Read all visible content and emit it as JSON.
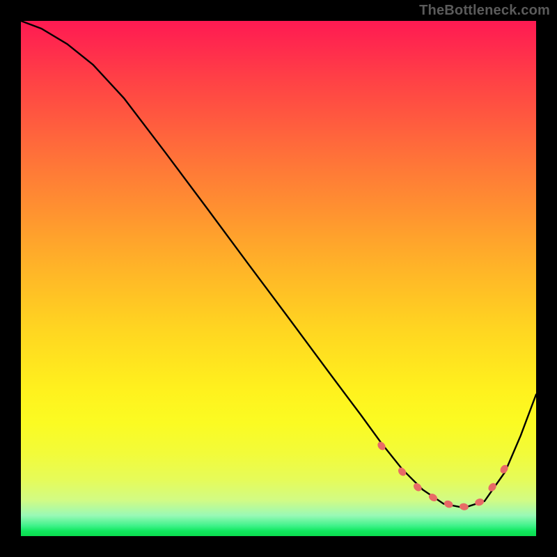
{
  "watermark": "TheBottleneck.com",
  "chart_data": {
    "type": "line",
    "title": "",
    "xlabel": "",
    "ylabel": "",
    "xlim": [
      0,
      1
    ],
    "ylim": [
      0,
      1
    ],
    "note": "Axes and scale are not labeled; x and y are normalized 0..1 where (0,0) is bottom-left of the plot area.",
    "series": [
      {
        "name": "curve",
        "x": [
          0.0,
          0.04,
          0.09,
          0.14,
          0.2,
          0.28,
          0.36,
          0.44,
          0.52,
          0.6,
          0.66,
          0.7,
          0.74,
          0.78,
          0.82,
          0.86,
          0.9,
          0.94,
          0.97,
          1.0
        ],
        "y": [
          1.0,
          0.985,
          0.955,
          0.915,
          0.85,
          0.745,
          0.638,
          0.53,
          0.423,
          0.315,
          0.235,
          0.18,
          0.13,
          0.09,
          0.063,
          0.055,
          0.068,
          0.125,
          0.195,
          0.275
        ]
      }
    ],
    "markers": {
      "name": "highlight-dots",
      "x": [
        0.7,
        0.74,
        0.77,
        0.8,
        0.83,
        0.86,
        0.89,
        0.915,
        0.938
      ],
      "y": [
        0.175,
        0.125,
        0.095,
        0.075,
        0.062,
        0.057,
        0.066,
        0.095,
        0.13
      ]
    },
    "gradient_stops": [
      {
        "pos": 0.0,
        "color": "#ff1a52"
      },
      {
        "pos": 0.5,
        "color": "#ffc020"
      },
      {
        "pos": 0.8,
        "color": "#f6fb2a"
      },
      {
        "pos": 0.97,
        "color": "#5af59a"
      },
      {
        "pos": 1.0,
        "color": "#0bdc4e"
      }
    ]
  }
}
